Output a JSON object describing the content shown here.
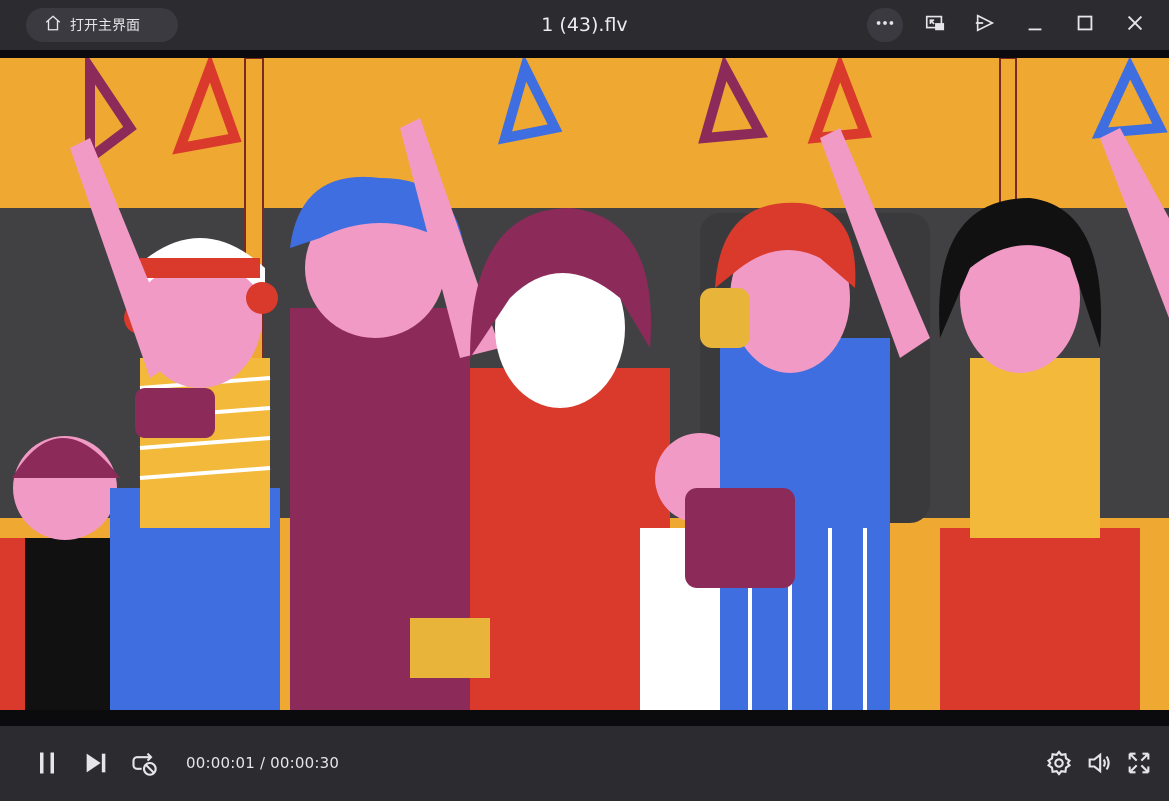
{
  "titlebar": {
    "home_label": "打开主界面",
    "file_title": "1 (43).flv"
  },
  "player": {
    "current_time": "00:00:01",
    "separator": "/",
    "duration": "00:00:30"
  },
  "icons": {
    "home": "home-icon",
    "more": "more-icon",
    "mini_window": "mini-window-icon",
    "pin": "pin-icon",
    "minimize": "minimize-icon",
    "maximize": "maximize-icon",
    "close": "close-icon",
    "pause": "pause-icon",
    "next": "next-icon",
    "loop": "loop-off-icon",
    "settings": "settings-icon",
    "volume": "volume-icon",
    "fullscreen": "fullscreen-icon"
  },
  "colors": {
    "bar_background": "#2b2b30",
    "video_letterbox": "#0b0b0d",
    "icon": "#e6e6ea"
  }
}
